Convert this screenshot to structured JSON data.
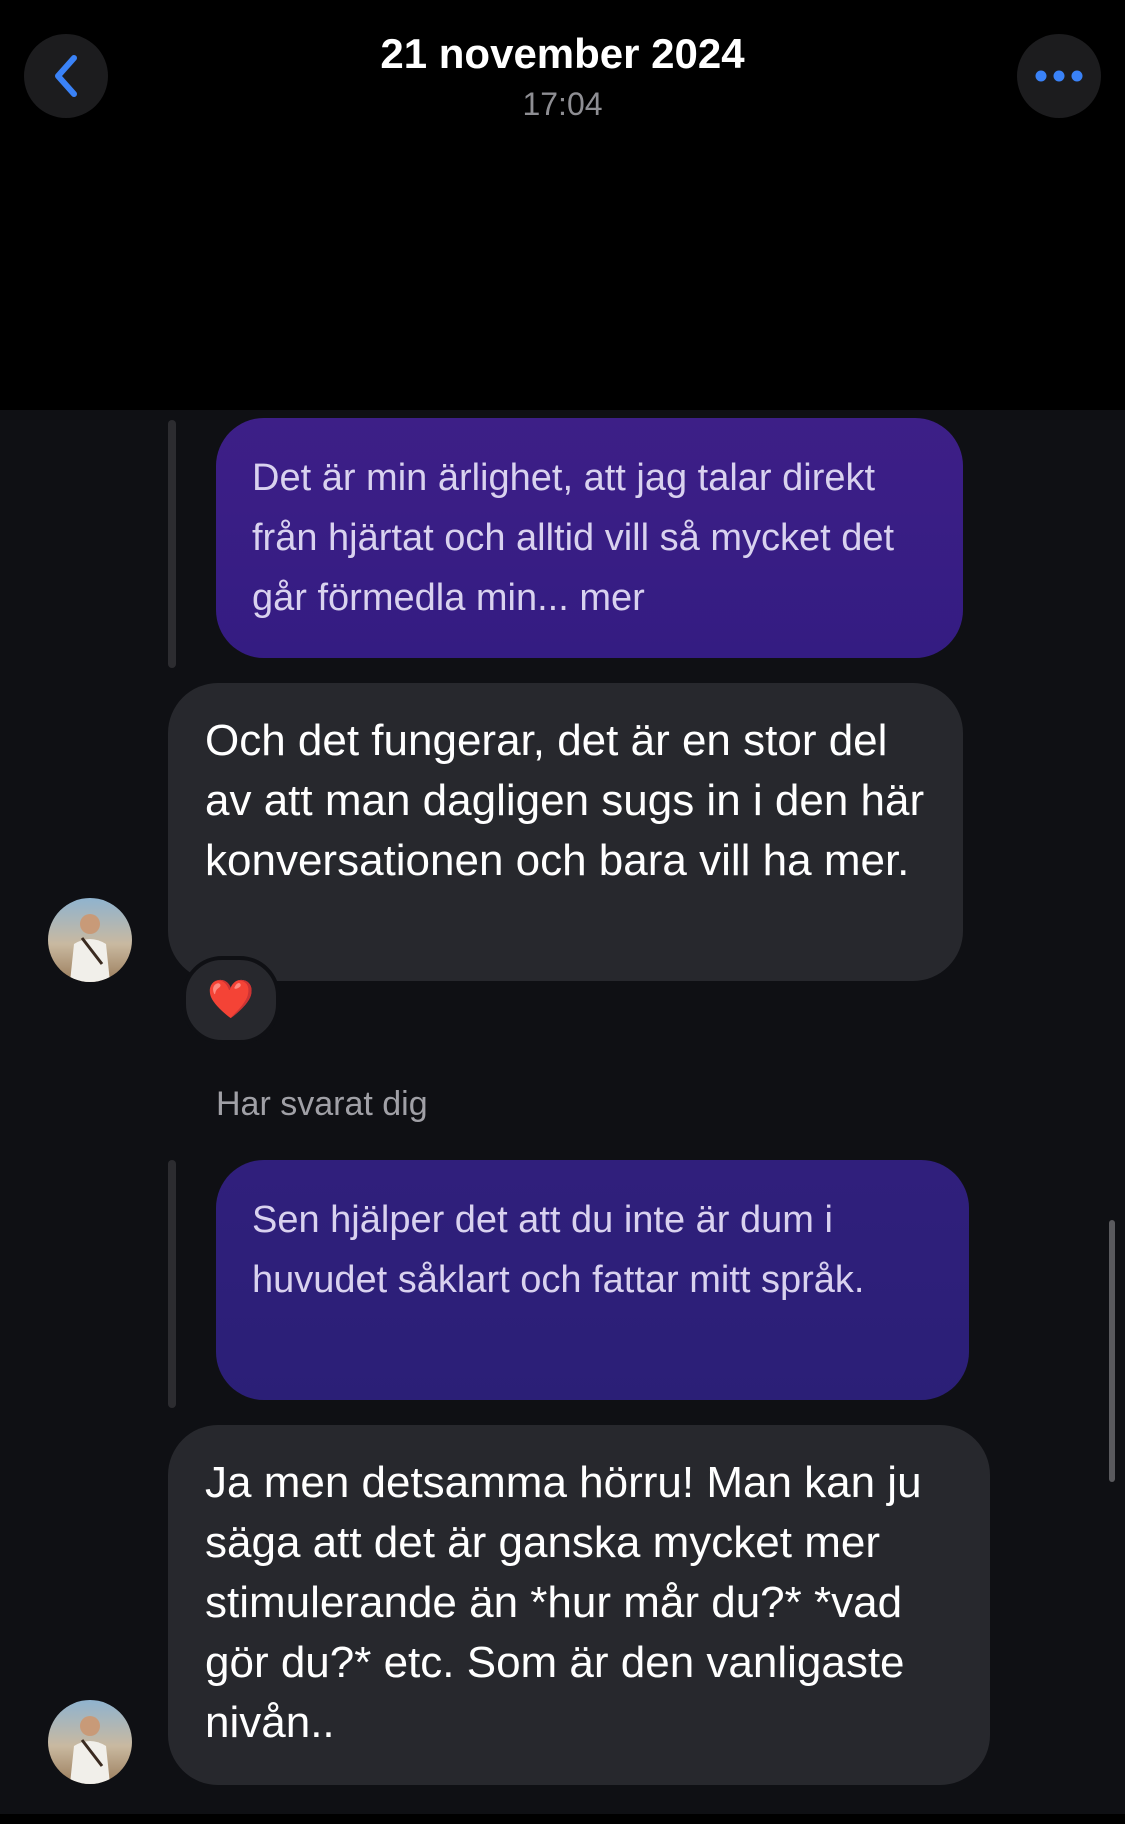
{
  "header": {
    "date": "21 november 2024",
    "time": "17:04",
    "back_icon": "chevron-left-icon",
    "more_icon": "ellipsis-icon",
    "accent": "#3a82f7"
  },
  "messages": [
    {
      "type": "sent",
      "text": "Det är min ärlighet, att jag talar direkt från hjärtat och alltid vill så mycket det går förmedla min... mer"
    },
    {
      "type": "received",
      "text": "Och det fungerar, det är en stor del av att man dagligen sugs in i den här konversationen och bara vill ha mer.",
      "reaction": "❤️"
    },
    {
      "type": "label",
      "text": "Har svarat dig"
    },
    {
      "type": "sent",
      "text": "Sen hjälper det att du inte är dum i huvudet såklart och fattar mitt språk."
    },
    {
      "type": "received",
      "text": "Ja men detsamma hörru! Man kan ju säga att det är ganska mycket mer stimulerande än *hur mår du?* *vad gör du?* etc. Som är den vanligaste nivån.."
    }
  ],
  "colors": {
    "sent_bubble_1": "#3d1f87",
    "sent_bubble_2": "#2e1f79",
    "received_bubble": "#27282d",
    "chat_background": "#0f1014"
  }
}
